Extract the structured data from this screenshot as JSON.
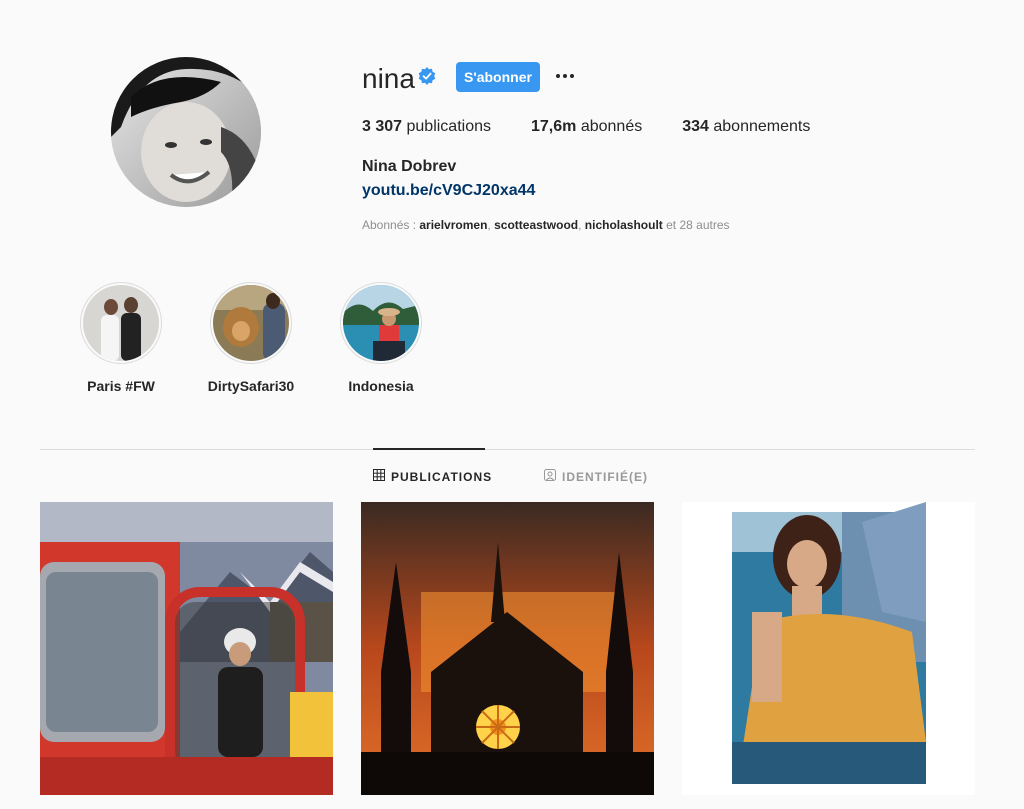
{
  "profile": {
    "username": "nina",
    "follow_label": "S'abonner",
    "full_name": "Nina Dobrev",
    "link": "youtu.be/cV9CJ20xa44",
    "stats": {
      "posts_count": "3 307",
      "posts_label": "publications",
      "followers_count": "17,6m",
      "followers_label": "abonnés",
      "following_count": "334",
      "following_label": "abonnements"
    },
    "followed_by": {
      "prefix": "Abonnés : ",
      "users": [
        "arielvromen",
        "scotteastwood",
        "nicholashoult"
      ],
      "suffix": "et 28 autres"
    }
  },
  "highlights": [
    {
      "label": "Paris #FW"
    },
    {
      "label": "DirtySafari30"
    },
    {
      "label": "Indonesia"
    }
  ],
  "tabs": [
    {
      "label": "PUBLICATIONS",
      "active": true
    },
    {
      "label": "IDENTIFIÉ(E)",
      "active": false
    }
  ],
  "colors": {
    "accent": "#3897f0",
    "link": "#003569",
    "background": "#fafafa"
  },
  "icons": [
    "verified-badge-icon",
    "more-options-icon",
    "grid-icon",
    "tagged-icon"
  ]
}
